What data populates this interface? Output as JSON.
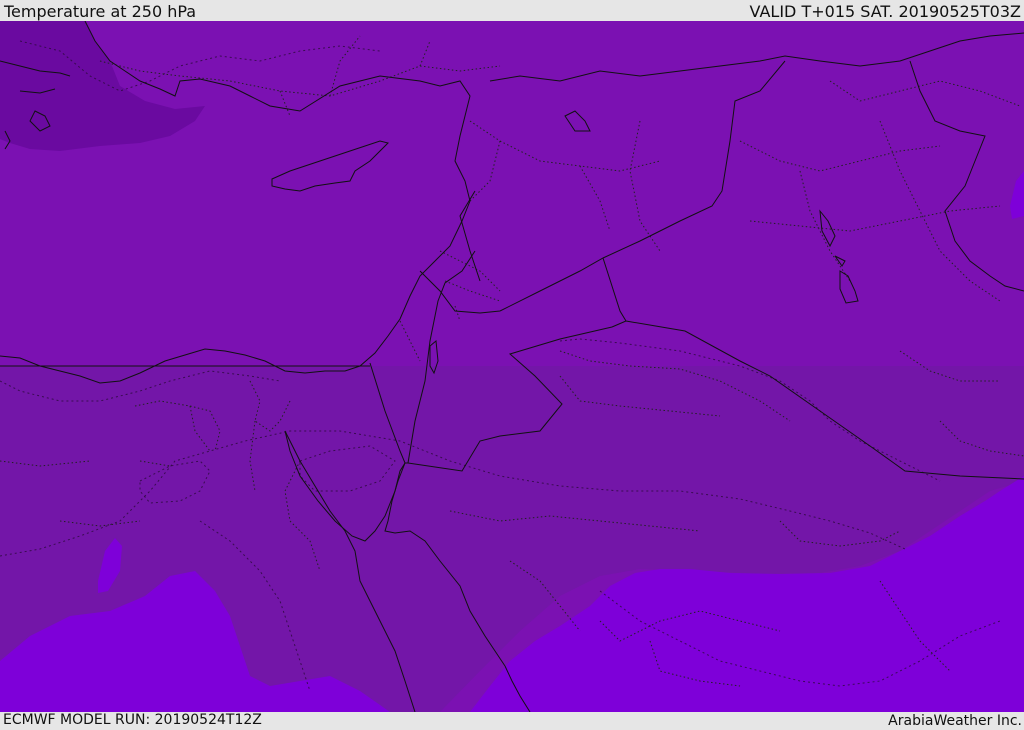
{
  "header": {
    "title": "Temperature at 250 hPa",
    "valid": "VALID T+015 SAT. 20190525T03Z"
  },
  "footer": {
    "model_run": "ECMWF MODEL RUN: 20190524T12Z",
    "credit": "ArabiaWeather Inc."
  },
  "colors": {
    "main_band": "#7b11b2",
    "southwest_band": "#7316a8",
    "cold_band": "#6a0aa0",
    "warm_band": "#7e00d9"
  }
}
